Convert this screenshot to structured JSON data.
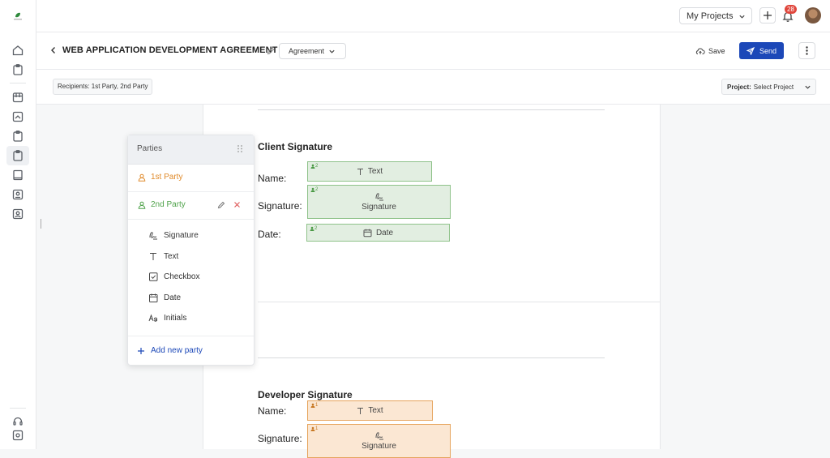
{
  "topbar": {
    "my_projects_label": "My Projects",
    "notification_count": "28"
  },
  "doc": {
    "title": "WEB APPLICATION DEVELOPMENT AGREEMENT",
    "type_label": "Agreement",
    "save_label": "Save",
    "send_label": "Send"
  },
  "subbar": {
    "recipients_label": "Recipients: 1st Party, 2nd Party",
    "project_prefix": "Project:",
    "project_value": "Select Project"
  },
  "panel": {
    "title": "Parties",
    "parties": [
      {
        "label": "1st Party",
        "color": "#e08a2a"
      },
      {
        "label": "2nd Party",
        "color": "#4fa24a"
      }
    ],
    "tools": [
      "Signature",
      "Text",
      "Checkbox",
      "Date",
      "Initials"
    ],
    "add_party_label": "Add new party"
  },
  "client": {
    "heading": "Client Signature",
    "labels": [
      "Name:",
      "Signature:",
      "Date:"
    ],
    "fields": [
      {
        "party": "2",
        "type": "Text",
        "icon": "text-icon"
      },
      {
        "party": "2",
        "type": "Signature",
        "icon": "signature-icon"
      },
      {
        "party": "2",
        "type": "Date",
        "icon": "calendar-icon"
      }
    ]
  },
  "developer": {
    "heading": "Developer Signature",
    "labels": [
      "Name:",
      "Signature:"
    ],
    "fields": [
      {
        "party": "1",
        "type": "Text",
        "icon": "text-icon"
      },
      {
        "party": "1",
        "type": "Signature",
        "icon": "signature-icon"
      }
    ]
  },
  "colors": {
    "accent": "#1c48b8",
    "party1": "#e08a2a",
    "party2": "#4fa24a"
  }
}
